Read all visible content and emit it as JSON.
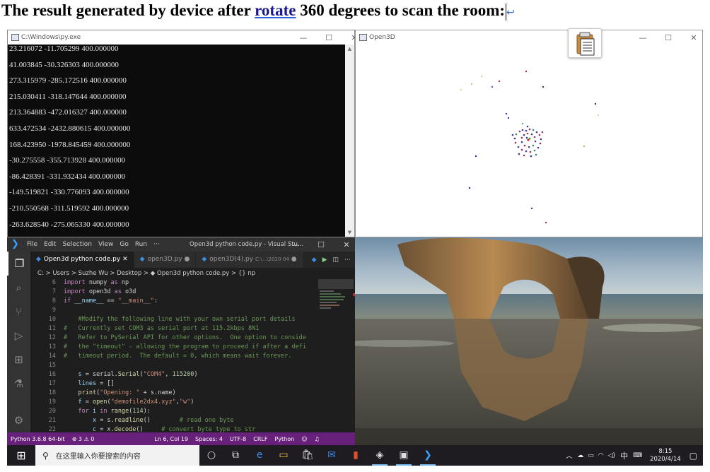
{
  "heading": {
    "pre": "The result generated by device after ",
    "link": "rotate",
    "post": " 360 degrees to scan the room:",
    "return_mark": "↩"
  },
  "console": {
    "title": "C:\\Windows\\py.exe",
    "lines": [
      "23.216072 -11.705299 400.000000",
      "41.003845 -30.326303 400.000000",
      "273.315979 -285.172516 400.000000",
      "215.030411 -318.147644 400.000000",
      "213.364883 -472.016327 400.000000",
      "633.472534 -2432.880615 400.000000",
      "168.423950 -1978.845459 400.000000",
      "-30.275558 -355.713928 400.000000",
      "-86.428391 -331.932434 400.000000",
      "-149.519821 -330.776093 400.000000",
      "-210.550568 -311.519592 400.000000",
      "-263.628540 -275.065330 400.000000"
    ]
  },
  "open3d": {
    "title": "Open3D"
  },
  "window_controls": {
    "min": "—",
    "max": "☐",
    "close": "✕"
  },
  "vscode": {
    "menu": [
      "File",
      "Edit",
      "Selection",
      "View",
      "Go",
      "Run",
      "···"
    ],
    "title": "Open3d python code.py - Visual Stu...",
    "tabs": [
      {
        "label": "Open3d python code.py",
        "mark": "✕",
        "extra": ""
      },
      {
        "label": "open3D.py",
        "mark": "●",
        "extra": ""
      },
      {
        "label": "open3D(4).py",
        "mark": "●",
        "extra": "C:\\...\\2020-04"
      }
    ],
    "breadcrumb": "C: > Users > Suzhe Wu > Desktop > ◆ Open3d python code.py > {} np",
    "line_numbers": [
      "6",
      "7",
      "8",
      "9",
      "10",
      "11",
      "12",
      "13",
      "14",
      "15",
      "16",
      "17",
      "18",
      "19",
      "20",
      "21",
      "22"
    ],
    "status": {
      "python": "Python 3.6.8 64-bit",
      "problems": "⊗ 3 ⚠ 0",
      "cursor": "Ln 6, Col 19",
      "spaces": "Spaces: 4",
      "encoding": "UTF-8",
      "eol": "CRLF",
      "lang": "Python"
    }
  },
  "taskbar": {
    "search_placeholder": "在这里输入你要搜索的内容",
    "ime": "中",
    "time": "8:15",
    "date": "2020/4/14"
  }
}
